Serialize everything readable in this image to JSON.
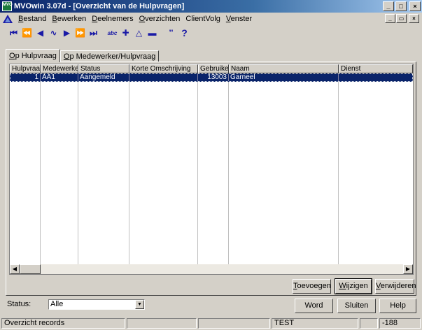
{
  "window": {
    "title": "MVOwin 3.07d - [Overzicht van de Hulpvragen]",
    "app_icon_text": "MVO",
    "minimize_glyph": "_",
    "maximize_glyph": "□",
    "close_glyph": "×"
  },
  "menu": {
    "items": [
      {
        "underline": "B",
        "rest": "estand"
      },
      {
        "underline": "B",
        "rest": "ewerken"
      },
      {
        "underline": "D",
        "rest": "eelnemers"
      },
      {
        "underline": "O",
        "rest": "verzichten"
      },
      {
        "underline": "",
        "rest": "ClientVolg"
      },
      {
        "underline": "V",
        "rest": "enster"
      }
    ],
    "child_minimize": "_",
    "child_restore": "▭",
    "child_close": "×"
  },
  "toolbar": {
    "icons": [
      "first-record-icon",
      "previous-page-icon",
      "previous-record-icon",
      "refresh-icon",
      "next-record-icon",
      "next-page-icon",
      "last-record-icon",
      "spell-check-icon",
      "add-icon",
      "edit-triangle-icon",
      "delete-icon",
      "quote-icon",
      "help-icon"
    ],
    "glyphs": [
      "⏮",
      "⏪",
      "◀",
      "∿",
      "▶",
      "⏩",
      "⏭",
      "abc",
      "✚",
      "△",
      "▬",
      "’’",
      "?"
    ]
  },
  "tabs": [
    {
      "underline": "O",
      "rest": "p Hulpvraag",
      "active": true
    },
    {
      "underline": "O",
      "rest": "p Medewerker/Hulpvraag",
      "active": false
    }
  ],
  "grid": {
    "columns": [
      "Hulpvraag",
      "Medewerker",
      "Status",
      "Korte Omschrijving",
      "Gebruiker",
      "Naam",
      "Dienst"
    ],
    "rows": [
      {
        "hulpvraag": "1",
        "medewerker": "AA1",
        "status": "Aangemeld",
        "korte_omschrijving": "",
        "gebruiker": "13003",
        "naam": "Garneel",
        "dienst": ""
      }
    ],
    "scroll_left": "◀",
    "scroll_right": "▶"
  },
  "buttons": {
    "toevoegen": {
      "underline": "T",
      "rest": "oevoegen"
    },
    "wijzigen": {
      "underline": "W",
      "rest": "ijzigen"
    },
    "verwijderen": {
      "underline": "V",
      "rest": "erwijderen"
    },
    "word": {
      "underline": "",
      "rest": "Word"
    },
    "sluiten": {
      "underline": "",
      "rest": "Sluiten"
    },
    "help": {
      "underline": "",
      "rest": "Help"
    }
  },
  "filter": {
    "label": "Status:",
    "value": "Alle",
    "arrow": "▼"
  },
  "statusbar": {
    "message": "Overzicht records",
    "panel2": "",
    "panel3": "",
    "env": "TEST",
    "panel5": "",
    "code": "-188"
  }
}
